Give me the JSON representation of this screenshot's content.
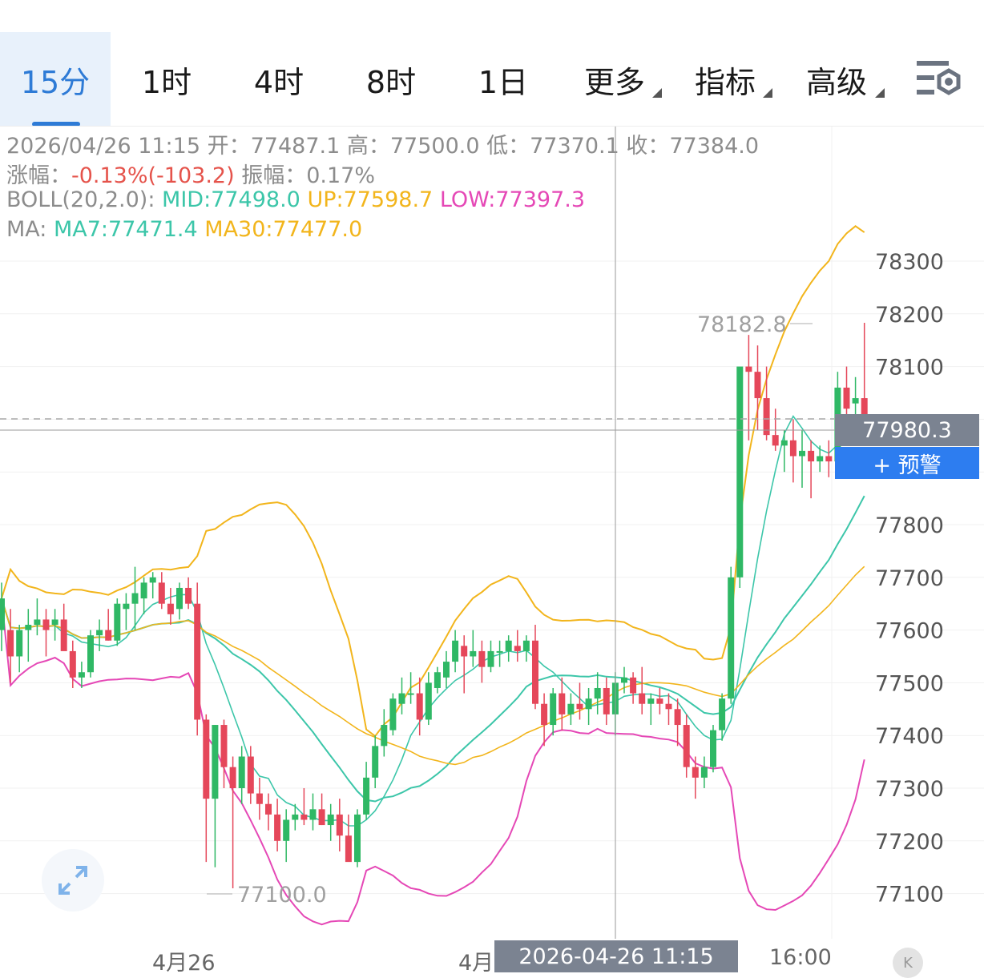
{
  "tabs": [
    {
      "label": "15分",
      "active": true
    },
    {
      "label": "1时"
    },
    {
      "label": "4时"
    },
    {
      "label": "8时"
    },
    {
      "label": "1日"
    },
    {
      "label": "更多",
      "dropdown": true
    },
    {
      "label": "指标",
      "dropdown": true
    },
    {
      "label": "高级",
      "dropdown": true
    }
  ],
  "info": {
    "datetime": "2026/04/26 11:15",
    "open_label": "开：",
    "open": "77487.1",
    "high_label": "高：",
    "high": "77500.0",
    "low_label": "低：",
    "low": "77370.1",
    "close_label": "收：",
    "close": "77384.0",
    "change_label": "涨幅：",
    "change": "-0.13%(-103.2)",
    "amplitude_label": "振幅：",
    "amplitude": "0.17%",
    "boll_label": "BOLL(20,2.0):",
    "boll_mid": "MID:77498.0",
    "boll_up": "UP:77598.7",
    "boll_low": "LOW:77397.3",
    "ma_label": "MA:",
    "ma7": "MA7:77471.4",
    "ma30": "MA30:77477.0"
  },
  "price_axis": [
    "78300",
    "78200",
    "78100",
    "77800",
    "77700",
    "77600",
    "77500",
    "77400",
    "77300",
    "77200",
    "77100"
  ],
  "current_price": "77980.3",
  "alert_button": "+ 预警",
  "high_marker": "78182.8",
  "low_marker": "77100.0",
  "x_axis": {
    "left": "4月26",
    "mid": "4月",
    "right": "16:00"
  },
  "crosshair_time": "2026-04-26 11:15",
  "colors": {
    "up": "#2fb865",
    "down": "#e5475a",
    "boll_up_low_upper": "#f2b51c",
    "boll_low": "#e548b6",
    "mid": "#3cc6a9",
    "accent": "#2e7bd6"
  },
  "chart_data": {
    "type": "candlestick",
    "price_range": [
      77050,
      78380
    ],
    "candles": [
      [
        77600,
        77690,
        77560,
        77660
      ],
      [
        77600,
        77640,
        77500,
        77550
      ],
      [
        77550,
        77610,
        77520,
        77600
      ],
      [
        77600,
        77640,
        77540,
        77610
      ],
      [
        77610,
        77660,
        77590,
        77620
      ],
      [
        77620,
        77640,
        77550,
        77600
      ],
      [
        77610,
        77640,
        77580,
        77620
      ],
      [
        77620,
        77650,
        77580,
        77560
      ],
      [
        77560,
        77580,
        77490,
        77510
      ],
      [
        77510,
        77540,
        77490,
        77520
      ],
      [
        77520,
        77600,
        77510,
        77590
      ],
      [
        77590,
        77620,
        77560,
        77600
      ],
      [
        77600,
        77640,
        77580,
        77580
      ],
      [
        77580,
        77660,
        77570,
        77650
      ],
      [
        77640,
        77670,
        77600,
        77650
      ],
      [
        77650,
        77720,
        77600,
        77670
      ],
      [
        77660,
        77700,
        77630,
        77690
      ],
      [
        77690,
        77710,
        77660,
        77700
      ],
      [
        77690,
        77710,
        77640,
        77650
      ],
      [
        77650,
        77680,
        77610,
        77630
      ],
      [
        77640,
        77690,
        77620,
        77680
      ],
      [
        77680,
        77700,
        77640,
        77650
      ],
      [
        77650,
        77690,
        77400,
        77430
      ],
      [
        77430,
        77440,
        77160,
        77280
      ],
      [
        77280,
        77420,
        77150,
        77420
      ],
      [
        77420,
        77430,
        77300,
        77340
      ],
      [
        77340,
        77360,
        77110,
        77300
      ],
      [
        77300,
        77380,
        77270,
        77360
      ],
      [
        77360,
        77380,
        77270,
        77290
      ],
      [
        77290,
        77320,
        77240,
        77270
      ],
      [
        77270,
        77290,
        77220,
        77250
      ],
      [
        77250,
        77280,
        77180,
        77200
      ],
      [
        77200,
        77260,
        77160,
        77240
      ],
      [
        77240,
        77270,
        77220,
        77250
      ],
      [
        77250,
        77300,
        77230,
        77240
      ],
      [
        77240,
        77290,
        77220,
        77260
      ],
      [
        77260,
        77290,
        77230,
        77230
      ],
      [
        77230,
        77270,
        77200,
        77250
      ],
      [
        77250,
        77280,
        77180,
        77210
      ],
      [
        77210,
        77250,
        77170,
        77160
      ],
      [
        77160,
        77260,
        77150,
        77250
      ],
      [
        77250,
        77350,
        77240,
        77320
      ],
      [
        77320,
        77400,
        77300,
        77380
      ],
      [
        77380,
        77450,
        77360,
        77420
      ],
      [
        77410,
        77480,
        77400,
        77470
      ],
      [
        77460,
        77510,
        77440,
        77480
      ],
      [
        77480,
        77520,
        77460,
        77480
      ],
      [
        77480,
        77510,
        77400,
        77430
      ],
      [
        77430,
        77520,
        77420,
        77500
      ],
      [
        77490,
        77530,
        77480,
        77520
      ],
      [
        77510,
        77560,
        77490,
        77540
      ],
      [
        77540,
        77600,
        77520,
        77580
      ],
      [
        77570,
        77590,
        77480,
        77550
      ],
      [
        77550,
        77600,
        77530,
        77560
      ],
      [
        77560,
        77580,
        77500,
        77530
      ],
      [
        77530,
        77580,
        77520,
        77560
      ],
      [
        77560,
        77580,
        77530,
        77560
      ],
      [
        77560,
        77590,
        77540,
        77580
      ],
      [
        77570,
        77600,
        77540,
        77560
      ],
      [
        77560,
        77590,
        77540,
        77580
      ],
      [
        77580,
        77610,
        77450,
        77460
      ],
      [
        77460,
        77480,
        77380,
        77420
      ],
      [
        77420,
        77490,
        77400,
        77480
      ],
      [
        77480,
        77510,
        77410,
        77440
      ],
      [
        77440,
        77480,
        77420,
        77460
      ],
      [
        77460,
        77500,
        77430,
        77450
      ],
      [
        77450,
        77490,
        77420,
        77470
      ],
      [
        77470,
        77520,
        77440,
        77490
      ],
      [
        77490,
        77510,
        77420,
        77440
      ],
      [
        77440,
        77520,
        77400,
        77500
      ],
      [
        77500,
        77530,
        77480,
        77510
      ],
      [
        77510,
        77520,
        77460,
        77480
      ],
      [
        77480,
        77530,
        77440,
        77460
      ],
      [
        77460,
        77480,
        77420,
        77470
      ],
      [
        77470,
        77490,
        77440,
        77460
      ],
      [
        77460,
        77480,
        77420,
        77450
      ],
      [
        77450,
        77470,
        77380,
        77420
      ],
      [
        77420,
        77440,
        77320,
        77340
      ],
      [
        77340,
        77360,
        77280,
        77320
      ],
      [
        77320,
        77360,
        77300,
        77340
      ],
      [
        77340,
        77420,
        77330,
        77410
      ],
      [
        77410,
        77480,
        77390,
        77470
      ],
      [
        77470,
        77720,
        77460,
        77700
      ],
      [
        77700,
        78060,
        77680,
        78100
      ],
      [
        78100,
        78160,
        77960,
        78090
      ],
      [
        78090,
        78140,
        77980,
        78040
      ],
      [
        78040,
        78100,
        77960,
        77970
      ],
      [
        77970,
        78020,
        77940,
        77950
      ],
      [
        77950,
        77980,
        77900,
        77960
      ],
      [
        77960,
        78000,
        77880,
        77930
      ],
      [
        77930,
        77980,
        77870,
        77940
      ],
      [
        77940,
        77960,
        77850,
        77920
      ],
      [
        77920,
        77950,
        77900,
        77930
      ],
      [
        77930,
        77960,
        77890,
        77920
      ],
      [
        77920,
        78090,
        77900,
        78060
      ],
      [
        78060,
        78100,
        77990,
        78020
      ],
      [
        78030,
        78080,
        77960,
        78040
      ],
      [
        78040,
        78183,
        77980,
        77980
      ]
    ]
  }
}
